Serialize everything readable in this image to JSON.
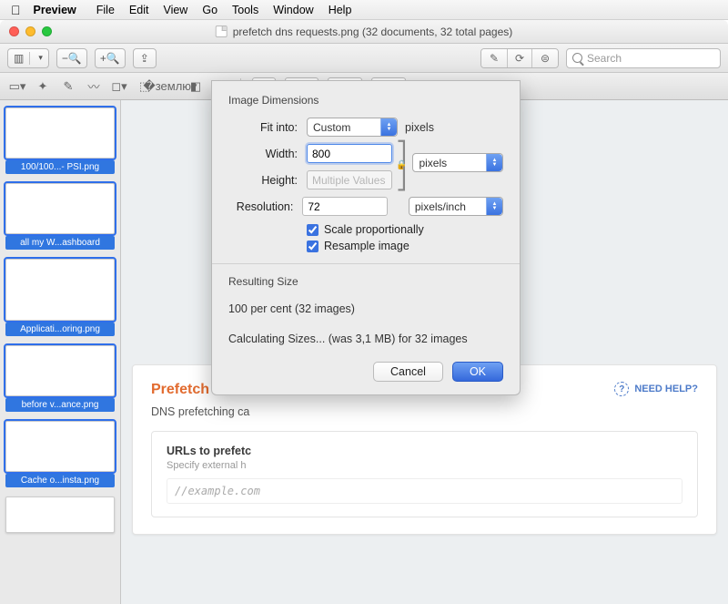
{
  "menubar": {
    "app": "Preview",
    "items": [
      "File",
      "Edit",
      "View",
      "Go",
      "Tools",
      "Window",
      "Help"
    ]
  },
  "window": {
    "title": "prefetch dns requests.png (32 documents, 32 total pages)"
  },
  "toolbar": {
    "search_placeholder": "Search"
  },
  "sidebar": {
    "thumbs": [
      {
        "label": "100/100...- PSI.png",
        "selected": true
      },
      {
        "label": "all my W...ashboard",
        "selected": true
      },
      {
        "label": "Applicati...oring.png",
        "selected": true
      },
      {
        "label": "before v...ance.png",
        "selected": true
      },
      {
        "label": "Cache o...insta.png",
        "selected": true
      },
      {
        "label": "",
        "selected": false
      }
    ]
  },
  "document": {
    "heading": "Prefetch DNS Re",
    "subtitle": "DNS prefetching ca",
    "box_title": "URLs to prefetc",
    "box_sub": "Specify external h",
    "mono": "//example.com",
    "help": "NEED HELP?"
  },
  "dialog": {
    "section1": "Image Dimensions",
    "fitinto_label": "Fit into:",
    "fitinto_value": "Custom",
    "fitinto_unit": "pixels",
    "width_label": "Width:",
    "width_value": "800",
    "height_label": "Height:",
    "height_value": "Multiple Values",
    "wh_unit": "pixels",
    "res_label": "Resolution:",
    "res_value": "72",
    "res_unit": "pixels/inch",
    "scale_label": "Scale proportionally",
    "resample_label": "Resample image",
    "section2": "Resulting Size",
    "result_line1": "100 per cent (32 images)",
    "result_line2": "Calculating Sizes... (was 3,1 MB) for 32 images",
    "cancel": "Cancel",
    "ok": "OK"
  }
}
